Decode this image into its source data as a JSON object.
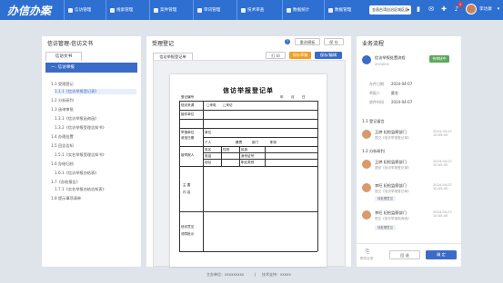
{
  "app": {
    "title": "办信办案",
    "user_name": "李达康",
    "notification_count": "2",
    "site_select": "金昌台湾自治区城区县"
  },
  "nav": [
    {
      "label": "信访管理",
      "icon": "home-icon"
    },
    {
      "label": "线索管理",
      "icon": "target-icon"
    },
    {
      "label": "案件管理",
      "icon": "clock-icon"
    },
    {
      "label": "审讯管理",
      "icon": "document-icon"
    },
    {
      "label": "技术审查",
      "icon": "search-doc-icon"
    },
    {
      "label": "数据统计",
      "icon": "chart-icon"
    },
    {
      "label": "数据管理",
      "icon": "database-icon"
    }
  ],
  "left": {
    "title": "信访管理-信访文书",
    "tab": "信访文书",
    "section": "一. 信访举报",
    "tree": [
      "1.1 受理登记",
      "1.1.1《信访举报登记表》",
      "1.2 分析研判",
      "1.3 函询审批",
      "1.3.1《信访举报函询函》",
      "1.3.2《信访举报受理告知书》",
      "1.4 办理处置",
      "1.5 回告告知",
      "1.5.1《实名举报受理告知书》",
      "1.6 办结归档",
      "1.6.1《信访举报办结表》",
      "1.7《办结报告》",
      "1.7.1《实名举报办结告知表》",
      "1.8 提示事项清单"
    ]
  },
  "center": {
    "title": "受理登记",
    "btn_select": "重选模板",
    "btn_save_top": "保 存",
    "doc_tab": "信访举报登记单",
    "btn_print": "打 印",
    "btn_save_draft": "保存草稿",
    "btn_save_edit": "保存/编辑",
    "doc": {
      "title": "信访举报登记单",
      "reg_number": "登记编号",
      "date_units": [
        "年",
        "月",
        "日"
      ],
      "source_label": "信访来源",
      "source_opts": [
        "□来电",
        "□来访"
      ],
      "rows": [
        "接件单位",
        "举报单位",
        "收信日期",
        "被举报人",
        "主 要",
        "内 容",
        "信访意见"
      ],
      "cells": [
        "单位",
        "个人",
        "籍贯",
        "部门",
        "职务",
        "姓名",
        "性别",
        "民族",
        "电话",
        "身份证号",
        "地址",
        "职业类别",
        "领导批示",
        "批示意见"
      ]
    }
  },
  "right": {
    "title": "业务流程",
    "apply_title": "信访举报处置流程",
    "apply_id": "2024001",
    "apply_status": "待审核中",
    "fields": [
      {
        "label": "办件日期",
        "value": "2024-04-07"
      },
      {
        "label": "举报人",
        "value": "匿名"
      },
      {
        "label": "收件时间",
        "value": "2024-04-07"
      }
    ],
    "step1": "1.1 登记留言",
    "step2": "1.2 分析研判",
    "timeline": [
      {
        "name": "王婷 纪检监察部门",
        "sub": "提交《信访举报登记单》",
        "date": "2024-04-07 10:45:45"
      },
      {
        "name": "王婷 纪检监察部门",
        "sub": "退回《信访举报登记单》",
        "date": "2024-04-07 10:45:45"
      },
      {
        "name": "李旺 纪检监察部门",
        "sub": "提交《信访举报登记单》",
        "date": "2024-04-07 10:45:45",
        "tag": "待处理意见"
      },
      {
        "name": "李旺 纪检监察部门",
        "sub": "提交《信访举报函询函》",
        "date": "2024-04-07 10:45:45",
        "tag": "待处理意见"
      }
    ],
    "btn_attach": "附件目录",
    "btn_back": "回 退",
    "btn_confirm": "确 定"
  },
  "footer": {
    "unit_label": "主办单位：xxxxxxxxx",
    "tech_label": "技术支持：xxxxx"
  },
  "colors": {
    "primary": "#2e6fd2",
    "accent": "#f0a020",
    "status_green": "#5aa85a"
  }
}
